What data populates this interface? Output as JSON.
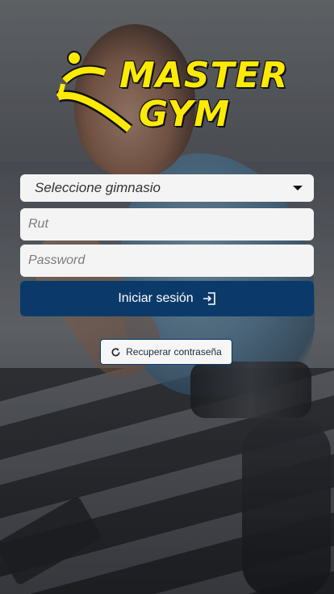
{
  "brand": {
    "line1": "MASTER",
    "line2": "GYM"
  },
  "form": {
    "gym_select": {
      "selected": "Seleccione gimnasio"
    },
    "rut": {
      "placeholder": "Rut"
    },
    "password": {
      "placeholder": "Password"
    },
    "login_label": "Iniciar sesión",
    "recover_label": "Recuperar contraseña"
  },
  "colors": {
    "logo": "#ffea00",
    "primary": "#0b3a6a",
    "field_bg": "#f4f4f4"
  },
  "icons": {
    "login": "login-arrow-icon",
    "recover": "refresh-icon",
    "select": "caret-down-icon"
  }
}
